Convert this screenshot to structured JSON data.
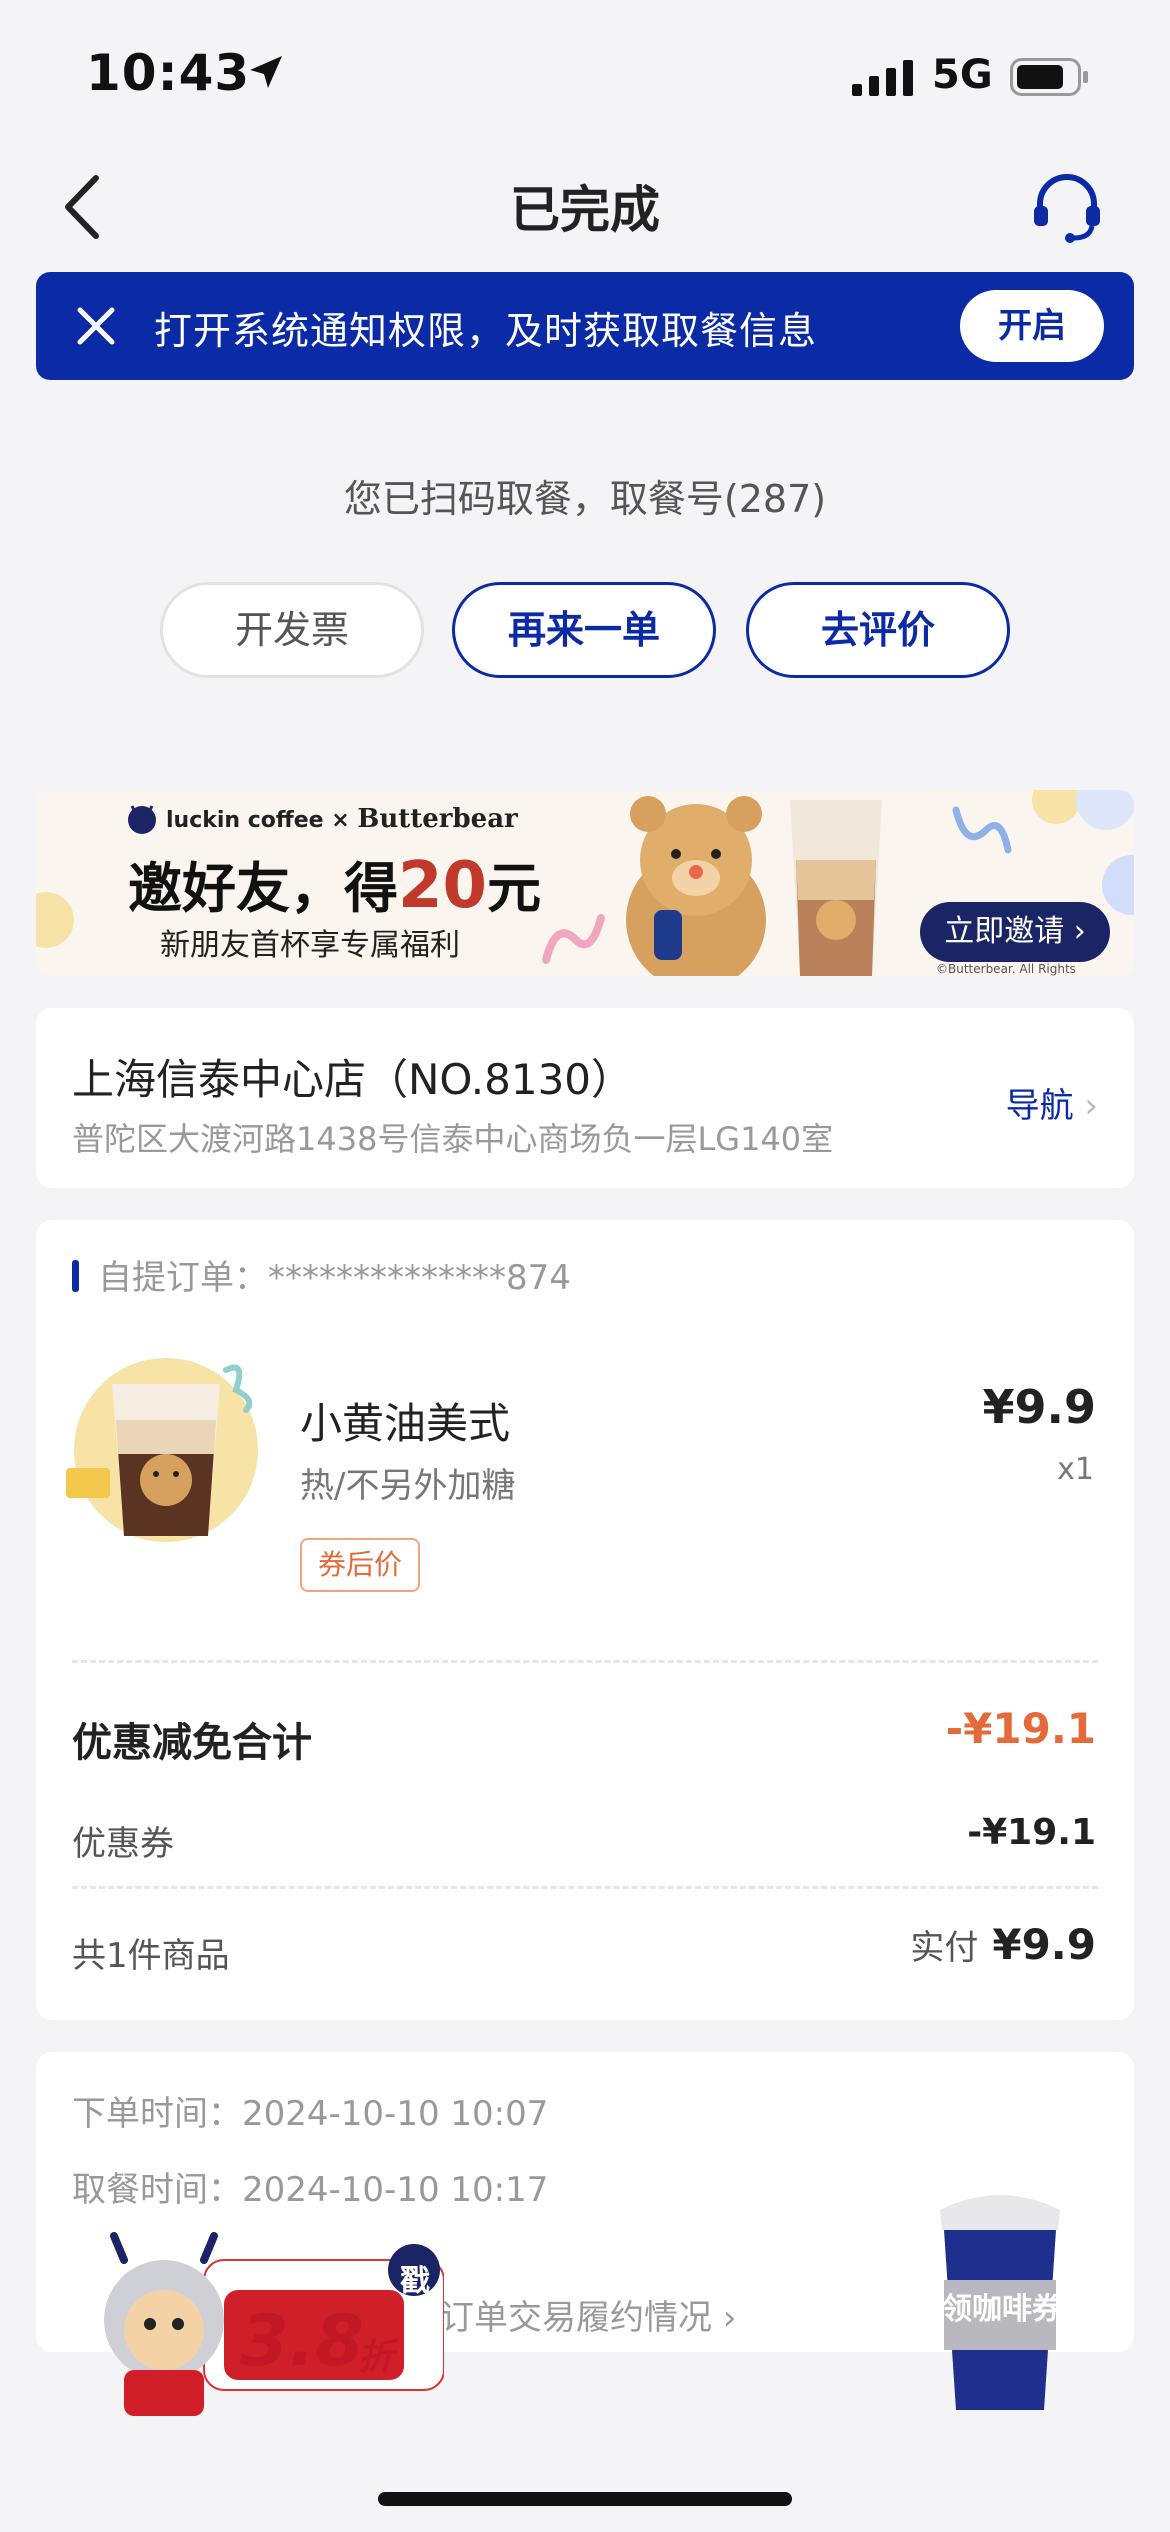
{
  "status_bar": {
    "time": "10:43",
    "network": "5G"
  },
  "nav": {
    "title": "已完成"
  },
  "notification": {
    "text": "打开系统通知权限，及时获取取餐信息",
    "button": "开启"
  },
  "pickup_message": "您已扫码取餐，取餐号(287)",
  "actions": {
    "invoice": "开发票",
    "reorder": "再来一单",
    "review": "去评价"
  },
  "promo": {
    "brand_left": "luckin coffee",
    "brand_x": "×",
    "brand_right": "Butterbear",
    "headline_pre": "邀好友，得",
    "headline_num": "20",
    "headline_post": "元",
    "subtitle": "新朋友首杯享专属福利",
    "button": "立即邀请",
    "copyright": "©Butterbear. All Rights Reserved"
  },
  "store": {
    "name": "上海信泰中心店（NO.8130）",
    "address": "普陀区大渡河路1438号信泰中心商场负一层LG140室",
    "nav_label": "导航"
  },
  "order": {
    "type_label": "自提订单：",
    "order_no": "**************874",
    "item": {
      "name": "小黄油美式",
      "options": "热/不另外加糖",
      "tag": "券后价",
      "price": "¥9.9",
      "qty": "x1"
    },
    "discount_total_label": "优惠减免合计",
    "discount_total_value": "-¥19.1",
    "coupon_label": "优惠券",
    "coupon_value": "-¥19.1",
    "count_label": "共1件商品",
    "paid_label": "实付",
    "paid_value": "¥9.9"
  },
  "times": {
    "order_time": "下单时间：2024-10-10 10:07",
    "pickup_time": "取餐时间：2024-10-10 10:17"
  },
  "trade_link": "订单交易履约情况",
  "floating": {
    "discount": "3.8",
    "discount_unit": "折",
    "stamp": "戳",
    "coupon": "领咖啡券"
  },
  "colors": {
    "brand_blue": "#0b2aa5",
    "discount_orange": "#e56a3a",
    "bg": "#f4f4f6"
  }
}
